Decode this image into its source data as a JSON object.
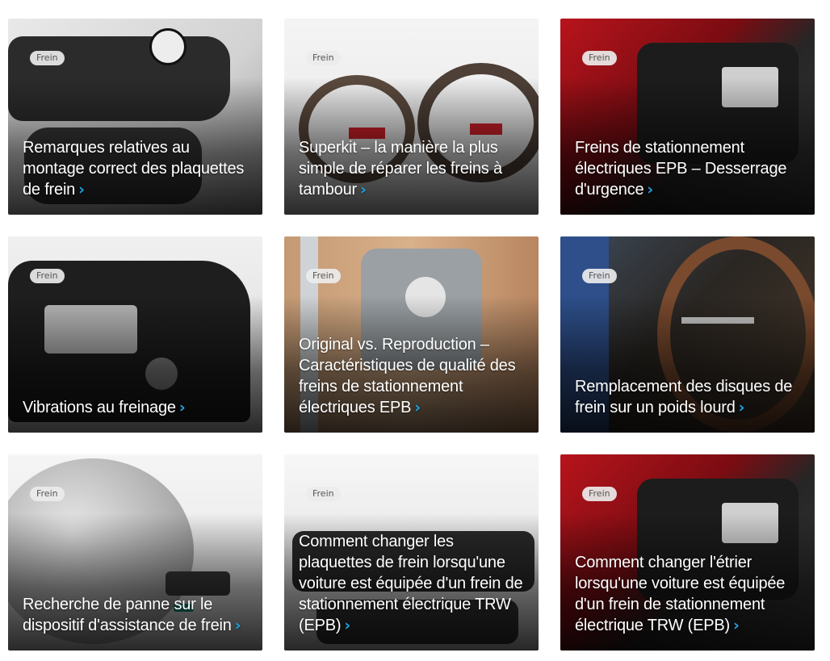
{
  "colors": {
    "accent": "#1fa2e0",
    "tag_bg": "#ebebeb",
    "title_text": "#ffffff"
  },
  "icons": {
    "chevron": "chevron-right-icon"
  },
  "cards": [
    {
      "tag": "Frein",
      "title": "Remarques relatives au montage correct des plaquettes de frein",
      "chevron": "›"
    },
    {
      "tag": "Frein",
      "title": "Superkit – la manière la plus simple de réparer les freins à tambour",
      "chevron": "›"
    },
    {
      "tag": "Frein",
      "title": "Freins de stationnement électriques EPB – Desserrage d'urgence",
      "chevron": "›"
    },
    {
      "tag": "Frein",
      "title": "Vibrations au freinage",
      "chevron": "›"
    },
    {
      "tag": "Frein",
      "title": "Original vs. Reproduction – Caractéristiques de qualité des freins de stationnement électriques EPB",
      "chevron": "›"
    },
    {
      "tag": "Frein",
      "title": "Remplacement des disques de frein sur un poids lourd",
      "chevron": "›"
    },
    {
      "tag": "Frein",
      "title": "Recherche de panne sur le dispositif d'assistance de frein",
      "chevron": "›"
    },
    {
      "tag": "Frein",
      "title": "Comment changer les plaquettes de frein lorsqu'une voiture est équipée d'un frein de stationnement électrique TRW (EPB)",
      "chevron": "›"
    },
    {
      "tag": "Frein",
      "title": "Comment changer l'étrier lorsqu'une voiture est équipée d'un frein de stationnement électrique TRW (EPB)",
      "chevron": "›"
    }
  ]
}
